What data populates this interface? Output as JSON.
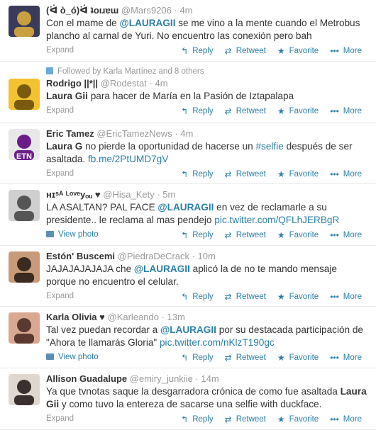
{
  "labels": {
    "expand": "Expand",
    "view_photo": "View photo",
    "reply": "Reply",
    "retweet": "Retweet",
    "favorite": "Favorite",
    "more": "More"
  },
  "tweets": [
    {
      "name": "(ᐛ ò_ó)ᐛ ʇoıɹɐɯ",
      "handle": "@Mars9206",
      "time": "4m",
      "avatar_colors": [
        "#3a3a5a",
        "#c8a040"
      ],
      "body_parts": [
        {
          "t": "Con el mame de "
        },
        {
          "t": "@LAURAGII",
          "c": "hl"
        },
        {
          "t": " se me vino a la mente cuando el Metrobus plancho al carnal de Yuri. No encuentro las conexión pero bah"
        }
      ],
      "footer": "expand"
    },
    {
      "followed": "Followed by Karla Martínez and 8 others",
      "name": "Rodrigo ||*||",
      "handle": "@Rodestat",
      "time": "4m",
      "avatar_colors": [
        "#f2c230",
        "#7a5a10"
      ],
      "body_parts": [
        {
          "t": "Laura Gii",
          "c": "bold"
        },
        {
          "t": " para hacer de María en la Pasión de Iztapalapa"
        }
      ],
      "footer": "expand"
    },
    {
      "name": "Eric Tamez",
      "handle": "@EricTamezNews",
      "time": "4m",
      "avatar_colors": [
        "#e8e8e8",
        "#6a1e8a"
      ],
      "avatar_text": "ETN",
      "body_parts": [
        {
          "t": "Laura G",
          "c": "bold"
        },
        {
          "t": " no pierde la oportunidad de hacerse un "
        },
        {
          "t": "#selfie",
          "c": "lnk"
        },
        {
          "t": " después de ser asaltada. "
        },
        {
          "t": "fb.me/2PtUMD7gV",
          "c": "lnk"
        }
      ],
      "footer": "expand"
    },
    {
      "name": "ʜɪˢᴬ ᴸᵒᵛᵉyₒᵤ ♥",
      "handle": "@Hisa_Kety",
      "time": "5m",
      "avatar_colors": [
        "#cfcfcf",
        "#555555"
      ],
      "body_parts": [
        {
          "t": "LA ASALTAN?  PAL  FACE  "
        },
        {
          "t": "@LAURAGII",
          "c": "hl"
        },
        {
          "t": " en vez  de reclamarle a su presidente.. le reclama al mas pendejo "
        },
        {
          "t": "pic.twitter.com/QFLhJERBgR",
          "c": "lnk"
        }
      ],
      "footer": "photo"
    },
    {
      "name": "Estón' Buscemi",
      "handle": "@PiedraDeCrack",
      "time": "10m",
      "avatar_colors": [
        "#c89a78",
        "#3a2a20"
      ],
      "body_parts": [
        {
          "t": "JAJAJAJAJAJA che "
        },
        {
          "t": "@LAURAGII",
          "c": "hl"
        },
        {
          "t": " aplicó la de no te mando mensaje porque no encuentro el celular."
        }
      ],
      "footer": "expand"
    },
    {
      "name": "Karla Olivia ♥",
      "handle": "@Karleando",
      "time": "13m",
      "avatar_colors": [
        "#d8a890",
        "#5a3a30"
      ],
      "body_parts": [
        {
          "t": "Tal vez puedan recordar a "
        },
        {
          "t": "@LAURAGII",
          "c": "hl"
        },
        {
          "t": " por su destacada participación de \"Ahora te llamarás Gloria\" "
        },
        {
          "t": "pic.twitter.com/nKlzT190gc",
          "c": "lnk"
        }
      ],
      "footer": "photo"
    },
    {
      "name": "Allison Guadalupe",
      "handle": "@emiry_junkiie",
      "time": "14m",
      "avatar_colors": [
        "#e0d8d0",
        "#3a3030"
      ],
      "body_parts": [
        {
          "t": "Ya que tvnotas saque la desgarradora crónica de como fue asaltada "
        },
        {
          "t": "Laura Gii",
          "c": "bold"
        },
        {
          "t": " y como tuvo la entereza de sacarse una selfie with duckface."
        }
      ],
      "footer": "expand"
    }
  ]
}
